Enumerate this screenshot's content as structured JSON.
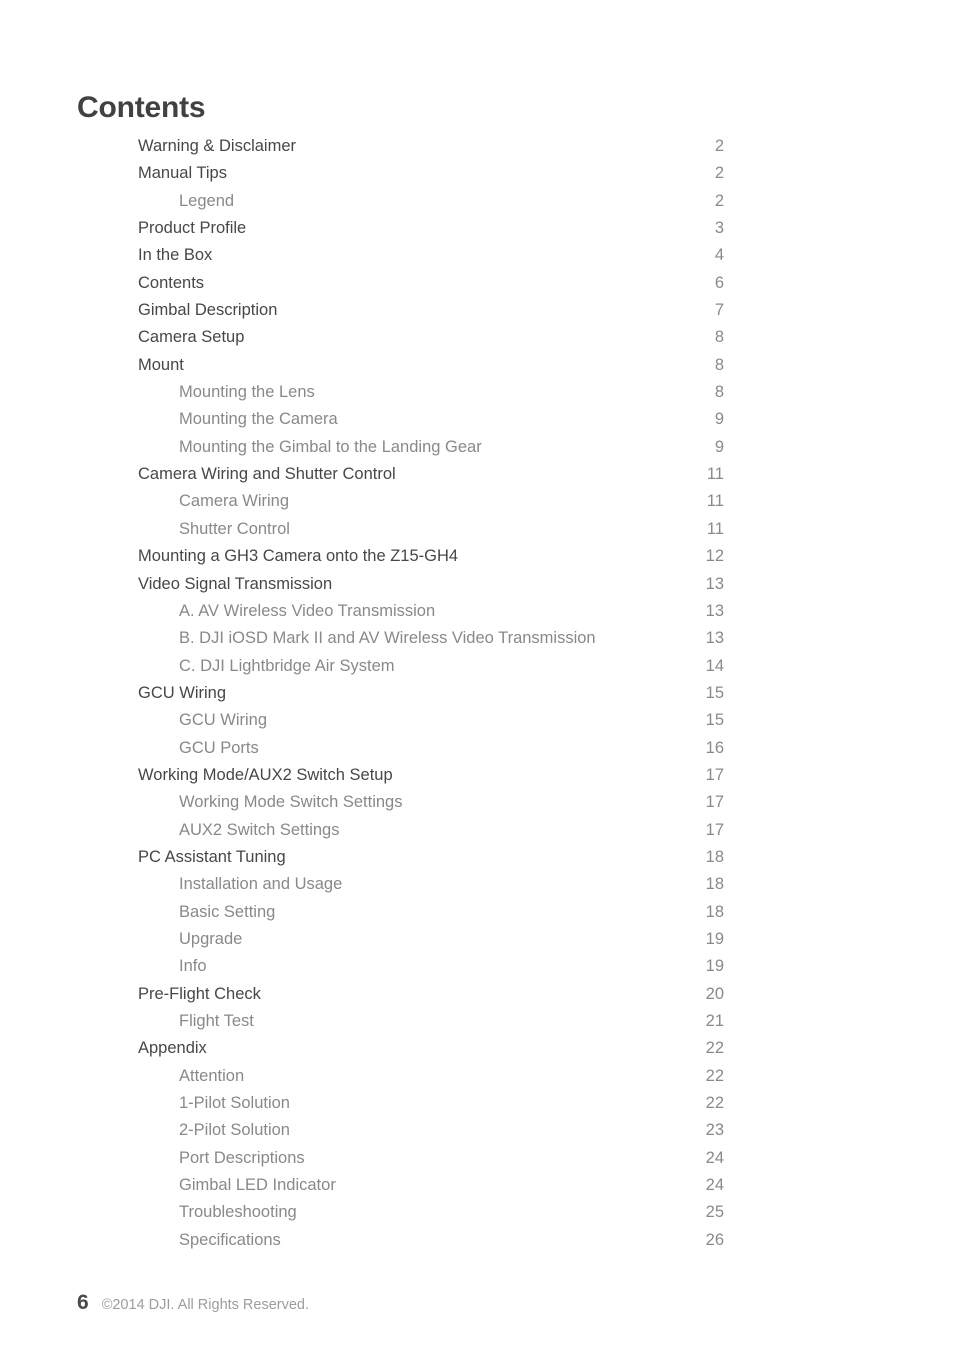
{
  "document": {
    "title": "Contents"
  },
  "toc": {
    "entries": [
      {
        "label": "Warning & Disclaimer",
        "page": "2",
        "level": 1
      },
      {
        "label": "Manual Tips",
        "page": "2",
        "level": 1
      },
      {
        "label": "Legend",
        "page": "2",
        "level": 2
      },
      {
        "label": "Product Profile",
        "page": "3",
        "level": 1
      },
      {
        "label": "In the Box",
        "page": "4",
        "level": 1
      },
      {
        "label": "Contents",
        "page": "6",
        "level": 1
      },
      {
        "label": "Gimbal Description",
        "page": "7",
        "level": 1
      },
      {
        "label": "Camera Setup",
        "page": "8",
        "level": 1
      },
      {
        "label": "Mount",
        "page": "8",
        "level": 1
      },
      {
        "label": "Mounting the Lens",
        "page": "8",
        "level": 2
      },
      {
        "label": "Mounting the Camera",
        "page": "9",
        "level": 2
      },
      {
        "label": "Mounting the Gimbal to the Landing Gear",
        "page": "9",
        "level": 2
      },
      {
        "label": "Camera Wiring and Shutter Control",
        "page": "11",
        "level": 1
      },
      {
        "label": "Camera Wiring",
        "page": "11",
        "level": 2
      },
      {
        "label": "Shutter Control",
        "page": "11",
        "level": 2
      },
      {
        "label": "Mounting a GH3 Camera onto the Z15-GH4",
        "page": "12",
        "level": 1
      },
      {
        "label": "Video Signal Transmission",
        "page": "13",
        "level": 1
      },
      {
        "label": "A. AV Wireless Video Transmission",
        "page": "13",
        "level": 2
      },
      {
        "label": "B. DJI iOSD Mark II and AV Wireless Video Transmission",
        "page": "13",
        "level": 2
      },
      {
        "label": "C. DJI Lightbridge Air System",
        "page": "14",
        "level": 2
      },
      {
        "label": "GCU Wiring",
        "page": "15",
        "level": 1
      },
      {
        "label": "GCU Wiring",
        "page": "15",
        "level": 2
      },
      {
        "label": "GCU Ports",
        "page": "16",
        "level": 2
      },
      {
        "label": "Working Mode/AUX2 Switch Setup",
        "page": "17",
        "level": 1
      },
      {
        "label": "Working Mode Switch Settings",
        "page": "17",
        "level": 2
      },
      {
        "label": "AUX2 Switch Settings",
        "page": "17",
        "level": 2
      },
      {
        "label": "PC Assistant Tuning",
        "page": "18",
        "level": 1
      },
      {
        "label": "Installation and Usage",
        "page": "18",
        "level": 2
      },
      {
        "label": "Basic Setting",
        "page": "18",
        "level": 2
      },
      {
        "label": "Upgrade",
        "page": "19",
        "level": 2
      },
      {
        "label": "Info",
        "page": "19",
        "level": 2
      },
      {
        "label": "Pre-Flight Check",
        "page": "20",
        "level": 1
      },
      {
        "label": "Flight Test",
        "page": "21",
        "level": 2
      },
      {
        "label": "Appendix",
        "page": "22",
        "level": 1
      },
      {
        "label": "Attention",
        "page": "22",
        "level": 2
      },
      {
        "label": "1-Pilot Solution",
        "page": "22",
        "level": 2
      },
      {
        "label": "2-Pilot Solution",
        "page": "23",
        "level": 2
      },
      {
        "label": "Port Descriptions",
        "page": "24",
        "level": 2
      },
      {
        "label": "Gimbal LED Indicator",
        "page": "24",
        "level": 2
      },
      {
        "label": "Troubleshooting",
        "page": "25",
        "level": 2
      },
      {
        "label": "Specifications",
        "page": "26",
        "level": 2
      }
    ]
  },
  "footer": {
    "page_number": "6",
    "copyright": "©2014 DJI. All Rights Reserved."
  },
  "colors": {
    "title": "#414141",
    "level_1_text": "#474747",
    "level_2_text": "#898989",
    "page_number_text": "#8a8a8a",
    "footer_page_number": "#4a4a4a",
    "footer_copyright": "#9d9d9d",
    "background": "#ffffff"
  }
}
